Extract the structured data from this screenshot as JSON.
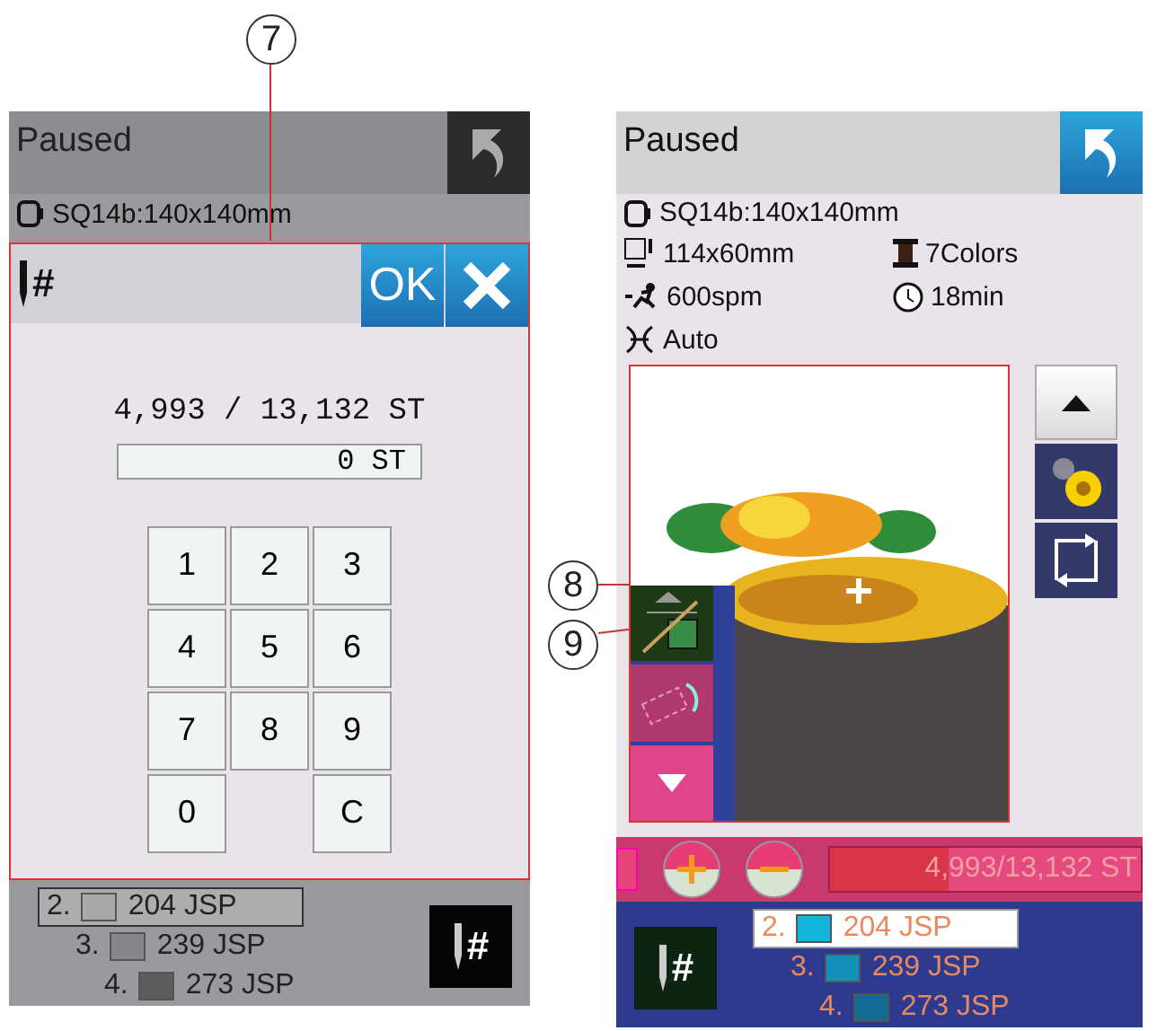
{
  "callouts": [
    {
      "label": "7"
    },
    {
      "label": "8"
    },
    {
      "label": "9"
    }
  ],
  "left_screen": {
    "status": "Paused",
    "hoop": "SQ14b:140x140mm",
    "dialog": {
      "title": "#",
      "ok": "OK",
      "count": "4,993 / 13,132 ST",
      "value": "0 ST",
      "keys": [
        "1",
        "2",
        "3",
        "4",
        "5",
        "6",
        "7",
        "8",
        "9",
        "0",
        "C"
      ]
    },
    "threads": [
      {
        "number": "2.",
        "name": "204 JSP",
        "color": "#a9a9ab",
        "selected": true
      },
      {
        "number": "3.",
        "name": "239 JSP",
        "color": "#87868a",
        "selected": false
      },
      {
        "number": "4.",
        "name": "273 JSP",
        "color": "#5b5c5e",
        "selected": false
      }
    ],
    "needle_button": "#"
  },
  "right_screen": {
    "status": "Paused",
    "hoop": "SQ14b:140x140mm",
    "size": "114x60mm",
    "colors": "7Colors",
    "speed": "600spm",
    "time": "18min",
    "mode": "Auto",
    "progress": {
      "text": "4,993/13,132 ST",
      "level": 0.38
    },
    "threads": [
      {
        "number": "2.",
        "name": "204 JSP",
        "color": "#12b6dc",
        "selected": true
      },
      {
        "number": "3.",
        "name": "239 JSP",
        "color": "#1391bb",
        "selected": false
      },
      {
        "number": "4.",
        "name": "273 JSP",
        "color": "#126b92",
        "selected": false
      }
    ],
    "needle_button": "#"
  }
}
